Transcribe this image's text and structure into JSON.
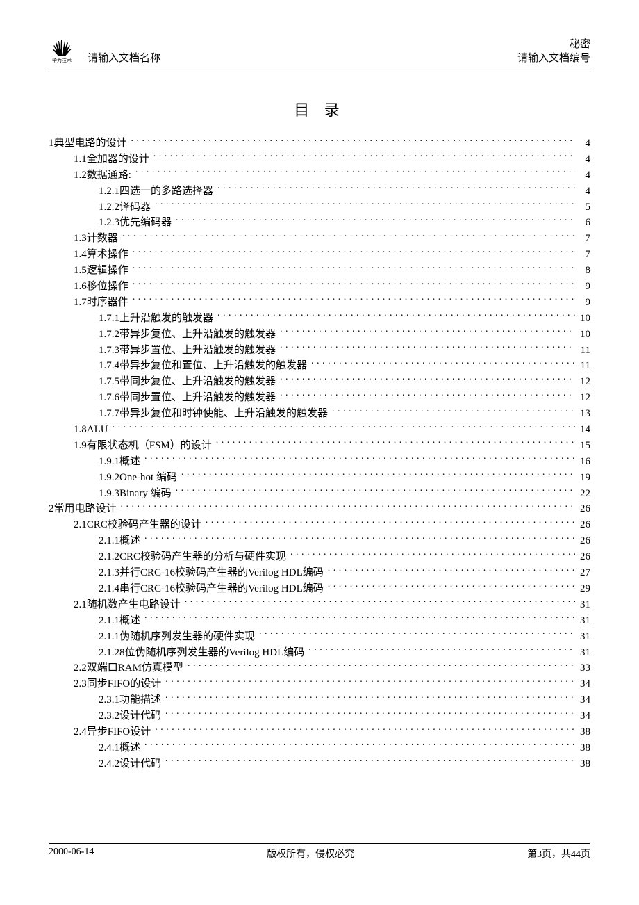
{
  "header": {
    "logo_caption": "华为技术",
    "doc_name": "请输入文档名称",
    "classification": "秘密",
    "doc_number": "请输入文档编号"
  },
  "title": "目 录",
  "toc": [
    {
      "level": 0,
      "label": "1典型电路的设计",
      "page": "4"
    },
    {
      "level": 1,
      "label": "1.1全加器的设计",
      "page": "4"
    },
    {
      "level": 1,
      "label": "1.2数据通路:",
      "page": "4"
    },
    {
      "level": 2,
      "label": "1.2.1四选一的多路选择器",
      "page": "4"
    },
    {
      "level": 2,
      "label": "1.2.2译码器",
      "page": "5"
    },
    {
      "level": 2,
      "label": "1.2.3优先编码器",
      "page": "6"
    },
    {
      "level": 1,
      "label": "1.3计数器",
      "page": "7"
    },
    {
      "level": 1,
      "label": "1.4算术操作",
      "page": "7"
    },
    {
      "level": 1,
      "label": "1.5逻辑操作",
      "page": "8"
    },
    {
      "level": 1,
      "label": "1.6移位操作",
      "page": "9"
    },
    {
      "level": 1,
      "label": "1.7时序器件",
      "page": "9"
    },
    {
      "level": 2,
      "label": "1.7.1上升沿触发的触发器",
      "page": "10"
    },
    {
      "level": 2,
      "label": "1.7.2带异步复位、上升沿触发的触发器",
      "page": "10"
    },
    {
      "level": 2,
      "label": "1.7.3带异步置位、上升沿触发的触发器",
      "page": "11"
    },
    {
      "level": 2,
      "label": "1.7.4带异步复位和置位、上升沿触发的触发器",
      "page": "11"
    },
    {
      "level": 2,
      "label": "1.7.5带同步复位、上升沿触发的触发器",
      "page": "12"
    },
    {
      "level": 2,
      "label": "1.7.6带同步置位、上升沿触发的触发器",
      "page": "12"
    },
    {
      "level": 2,
      "label": "1.7.7带异步复位和时钟使能、上升沿触发的触发器",
      "page": "13"
    },
    {
      "level": 1,
      "label": "1.8ALU",
      "page": "14"
    },
    {
      "level": 1,
      "label": "1.9有限状态机（FSM）的设计",
      "page": "15"
    },
    {
      "level": 2,
      "label": "1.9.1概述",
      "page": "16"
    },
    {
      "level": 2,
      "label": "1.9.2One-hot 编码",
      "page": "19"
    },
    {
      "level": 2,
      "label": "1.9.3Binary 编码",
      "page": "22"
    },
    {
      "level": 0,
      "label": "2常用电路设计",
      "page": "26"
    },
    {
      "level": 1,
      "label": "2.1CRC校验码产生器的设计",
      "page": "26"
    },
    {
      "level": 2,
      "label": "2.1.1概述",
      "page": "26"
    },
    {
      "level": 2,
      "label": "2.1.2CRC校验码产生器的分析与硬件实现",
      "page": "26"
    },
    {
      "level": 2,
      "label": "2.1.3并行CRC-16校验码产生器的Verilog HDL编码",
      "page": "27"
    },
    {
      "level": 2,
      "label": "2.1.4串行CRC-16校验码产生器的Verilog HDL编码",
      "page": "29"
    },
    {
      "level": 1,
      "label": "2.1随机数产生电路设计",
      "page": "31"
    },
    {
      "level": 2,
      "label": "2.1.1概述",
      "page": "31"
    },
    {
      "level": 2,
      "label": "2.1.1伪随机序列发生器的硬件实现",
      "page": "31"
    },
    {
      "level": 2,
      "label": "2.1.28位伪随机序列发生器的Verilog HDL编码",
      "page": "31"
    },
    {
      "level": 1,
      "label": "2.2双端口RAM仿真模型",
      "page": "33"
    },
    {
      "level": 1,
      "label": "2.3同步FIFO的设计",
      "page": "34"
    },
    {
      "level": 2,
      "label": "2.3.1功能描述",
      "page": "34"
    },
    {
      "level": 2,
      "label": "2.3.2设计代码",
      "page": "34"
    },
    {
      "level": 1,
      "label": "2.4异步FIFO设计",
      "page": "38"
    },
    {
      "level": 2,
      "label": "2.4.1概述",
      "page": "38"
    },
    {
      "level": 2,
      "label": "2.4.2设计代码",
      "page": "38"
    }
  ],
  "footer": {
    "date": "2000-06-14",
    "copyright": "版权所有，侵权必究",
    "page_info": "第3页，共44页"
  }
}
